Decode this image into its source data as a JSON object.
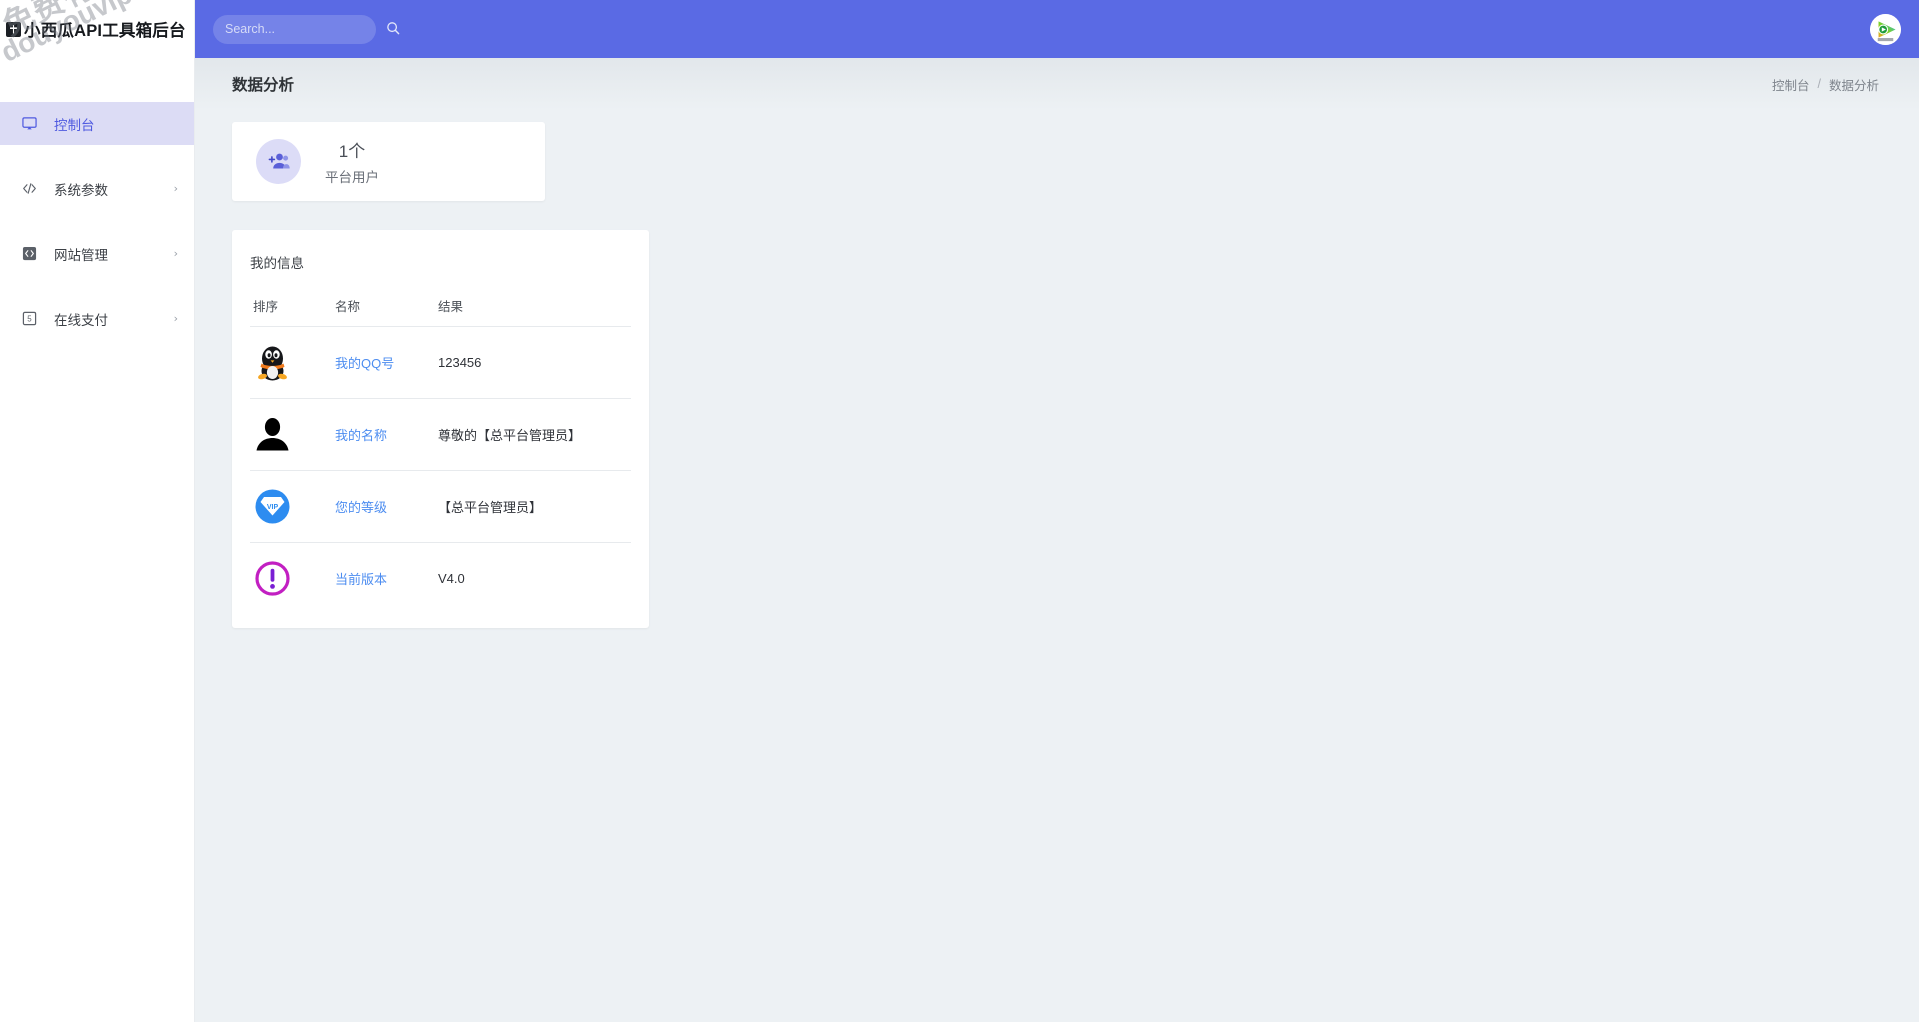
{
  "sidebar": {
    "brand": {
      "mark_icon": "plus-badge-icon",
      "title": "小西瓜API工具箱后台"
    },
    "watermark": {
      "line1": "免费有综合资源网",
      "line2": "douyouvip.com"
    },
    "items": [
      {
        "label": "控制台",
        "icon": "monitor-icon",
        "active": true,
        "has_chevron": false,
        "chevron": ""
      },
      {
        "label": "系统参数",
        "icon": "code-icon",
        "active": false,
        "has_chevron": true,
        "chevron": "›"
      },
      {
        "label": "网站管理",
        "icon": "code-square-icon",
        "active": false,
        "has_chevron": true,
        "chevron": "›"
      },
      {
        "label": "在线支付",
        "icon": "money-icon",
        "active": false,
        "has_chevron": true,
        "chevron": "›"
      }
    ]
  },
  "topbar": {
    "search": {
      "placeholder": "Search...",
      "value": "",
      "icon": "search-icon"
    },
    "avatar": {
      "icon": "play-logo-avatar"
    }
  },
  "page": {
    "title": "数据分析",
    "breadcrumb": {
      "root": "控制台",
      "separator": "/",
      "current": "数据分析"
    }
  },
  "stat_card": {
    "icon": "add-users-icon",
    "value": "1个",
    "label": "平台用户"
  },
  "info_card": {
    "title": "我的信息",
    "columns": {
      "order": "排序",
      "name": "名称",
      "result": "结果"
    },
    "rows": [
      {
        "icon": "qq-penguin-icon",
        "name": "我的QQ号",
        "value": "123456"
      },
      {
        "icon": "person-silhouette-icon",
        "name": "我的名称",
        "value": "尊敬的【总平台管理员】"
      },
      {
        "icon": "vip-diamond-icon",
        "name": "您的等级",
        "value": "【总平台管理员】"
      },
      {
        "icon": "exclamation-circle-icon",
        "name": "当前版本",
        "value": "V4.0"
      }
    ]
  },
  "colors": {
    "brand_indigo": "#5a6ae4",
    "active_nav_bg": "#dcdcf5",
    "active_nav_text": "#4f5ae0",
    "page_bg": "#edf1f4",
    "link_blue": "#4d8df0",
    "vip_blue": "#2d8cf0",
    "version_magenta": "#c21fc2"
  }
}
